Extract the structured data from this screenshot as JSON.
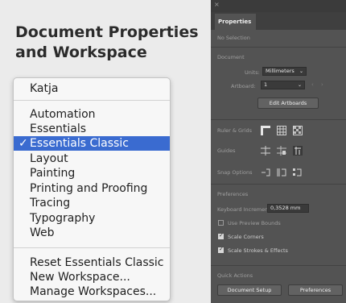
{
  "title": {
    "line1": "Document Properties",
    "line2": "and Workspace"
  },
  "menu": {
    "current": "Katja",
    "workspaces": [
      "Automation",
      "Essentials",
      "Essentials Classic",
      "Layout",
      "Painting",
      "Printing and Proofing",
      "Tracing",
      "Typography",
      "Web"
    ],
    "selected_index": 2,
    "check_glyph": "✓",
    "actions": [
      "Reset Essentials Classic",
      "New Workspace...",
      "Manage Workspaces..."
    ]
  },
  "panel": {
    "close_glyph": "×",
    "tab": "Properties",
    "no_selection": "No Selection",
    "document_heading": "Document",
    "units_label": "Units:",
    "units_value": "Millimeters",
    "artboard_label": "Artboard:",
    "artboard_value": "1",
    "edit_artboards": "Edit Artboards",
    "rulers_grids": "Ruler & Grids",
    "guides": "Guides",
    "snap_options": "Snap Options",
    "preferences_heading": "Preferences",
    "keyboard_increment_label": "Keyboard Increment:",
    "keyboard_increment_value": "0,3528 mm",
    "use_preview_bounds": "Use Preview Bounds",
    "scale_corners": "Scale Corners",
    "scale_strokes": "Scale Strokes & Effects",
    "checks": {
      "use_preview_bounds": false,
      "scale_corners": true,
      "scale_strokes": true
    },
    "quick_actions": "Quick Actions",
    "document_setup": "Document Setup",
    "preferences_button": "Preferences"
  },
  "colors": {
    "menu_highlight": "#3a6bd0",
    "panel_bg": "#535353"
  }
}
